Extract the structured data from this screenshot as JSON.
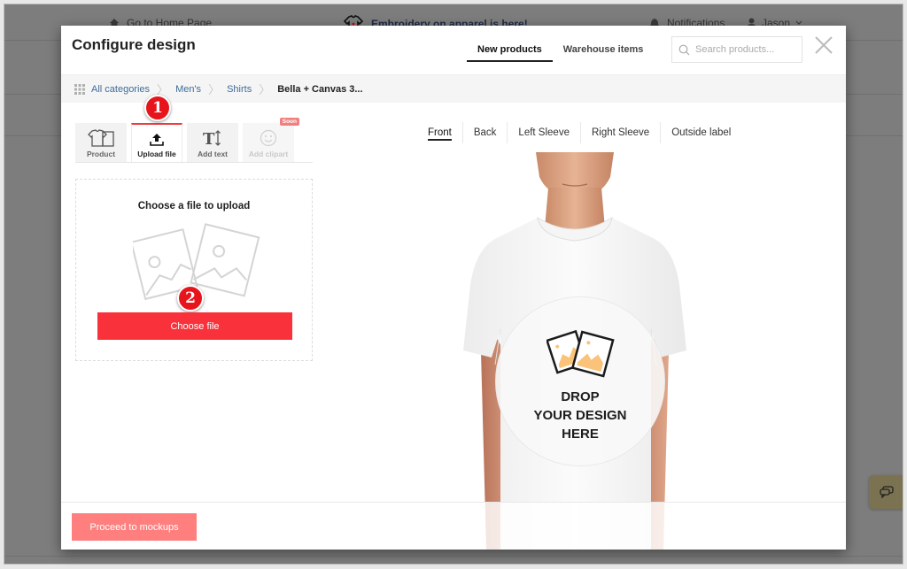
{
  "background": {
    "topbar": {
      "home_label": "Go to Home Page",
      "promo_label": "Embroidery on apparel is here!",
      "notifications_label": "Notifications",
      "user_label": "Jason"
    }
  },
  "modal": {
    "title": "Configure design",
    "top_tabs": [
      {
        "label": "New products",
        "active": true
      },
      {
        "label": "Warehouse items",
        "active": false
      }
    ],
    "search": {
      "placeholder": "Search products...",
      "value": ""
    },
    "breadcrumb": {
      "items": [
        "All categories",
        "Men's",
        "Shirts"
      ],
      "current": "Bella + Canvas 3..."
    },
    "tool_tabs": [
      {
        "label": "Product",
        "icon": "tshirt-icon"
      },
      {
        "label": "Upload file",
        "icon": "upload-icon",
        "active": true
      },
      {
        "label": "Add text",
        "icon": "text-resize-icon"
      },
      {
        "label": "Add clipart",
        "icon": "smiley-icon",
        "disabled": true,
        "badge": "Soon"
      }
    ],
    "step_badges": [
      "1",
      "2"
    ],
    "upload_panel": {
      "title": "Choose a file to upload",
      "button_label": "Choose file"
    },
    "view_tabs": [
      {
        "label": "Front",
        "active": true
      },
      {
        "label": "Back"
      },
      {
        "label": "Left Sleeve"
      },
      {
        "label": "Right Sleeve"
      },
      {
        "label": "Outside label"
      }
    ],
    "drop_zone": {
      "line1": "DROP",
      "line2": "YOUR DESIGN",
      "line3": "HERE"
    },
    "footer": {
      "proceed_label": "Proceed to mockups"
    }
  },
  "colors": {
    "accent_red": "#f9313a",
    "proceed_disabled": "#ff7f7f",
    "link_blue": "#3e6c9b",
    "drop_icon_orange": "#fbc27a"
  }
}
